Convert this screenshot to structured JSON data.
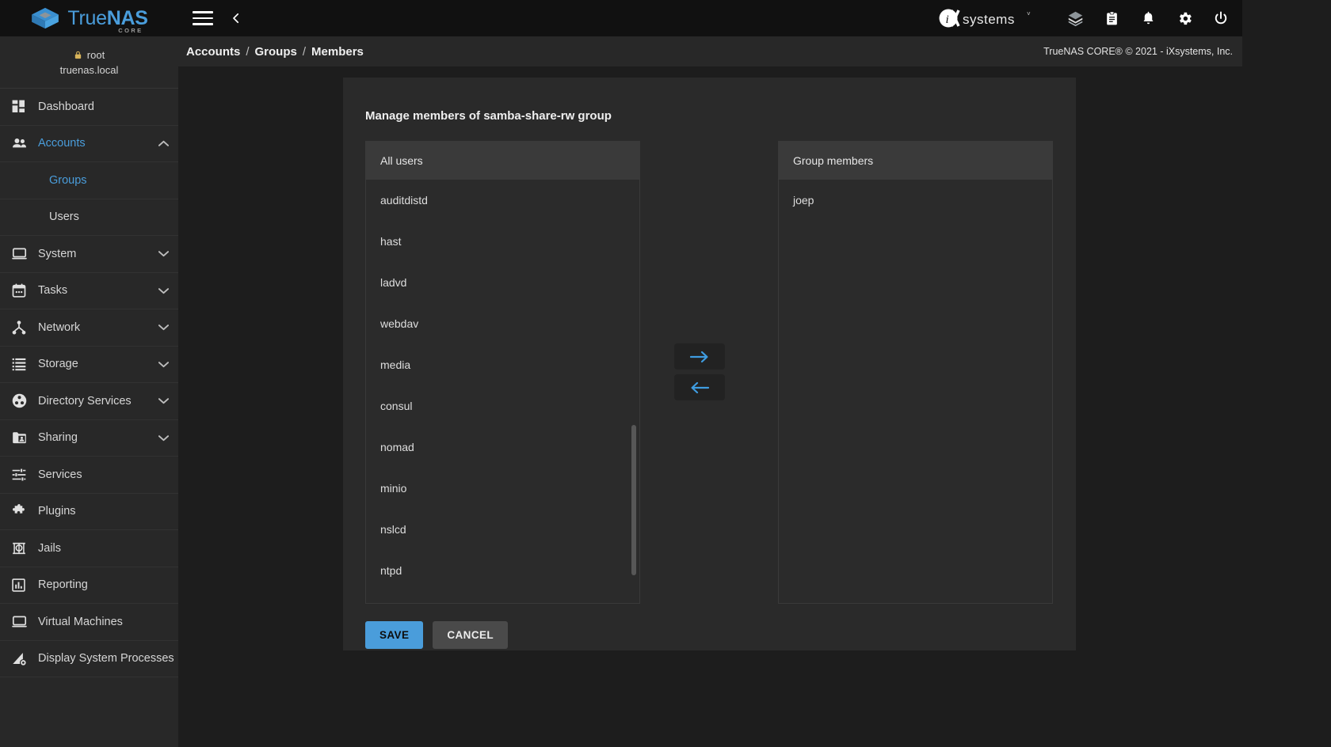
{
  "brand": {
    "name_part1": "True",
    "name_part2": "NAS",
    "edition": "CORE",
    "vendor": "iXsystems"
  },
  "topbar": {
    "menu_icon": "hamburger-icon",
    "back_icon": "chevron-left-icon",
    "icons": [
      {
        "name": "cube-stack-icon",
        "label": ""
      },
      {
        "name": "clipboard-icon",
        "label": ""
      },
      {
        "name": "bell-icon",
        "label": ""
      },
      {
        "name": "gear-icon",
        "label": ""
      },
      {
        "name": "power-icon",
        "label": ""
      }
    ]
  },
  "sidebar": {
    "user": {
      "username": "root",
      "hostname": "truenas.local",
      "lock_icon": "lock-icon"
    },
    "items": [
      {
        "label": "Dashboard",
        "icon": "dashboard-icon",
        "active": false,
        "expandable": false,
        "sub": false
      },
      {
        "label": "Accounts",
        "icon": "accounts-icon",
        "active": true,
        "expandable": true,
        "expanded": true,
        "sub": false
      },
      {
        "label": "Groups",
        "icon": "",
        "active": true,
        "expandable": false,
        "sub": true
      },
      {
        "label": "Users",
        "icon": "",
        "active": false,
        "expandable": false,
        "sub": true
      },
      {
        "label": "System",
        "icon": "system-icon",
        "active": false,
        "expandable": true,
        "expanded": false,
        "sub": false
      },
      {
        "label": "Tasks",
        "icon": "tasks-icon",
        "active": false,
        "expandable": true,
        "expanded": false,
        "sub": false
      },
      {
        "label": "Network",
        "icon": "network-icon",
        "active": false,
        "expandable": true,
        "expanded": false,
        "sub": false
      },
      {
        "label": "Storage",
        "icon": "storage-icon",
        "active": false,
        "expandable": true,
        "expanded": false,
        "sub": false
      },
      {
        "label": "Directory Services",
        "icon": "directory-services-icon",
        "active": false,
        "expandable": true,
        "expanded": false,
        "sub": false
      },
      {
        "label": "Sharing",
        "icon": "sharing-icon",
        "active": false,
        "expandable": true,
        "expanded": false,
        "sub": false
      },
      {
        "label": "Services",
        "icon": "services-icon",
        "active": false,
        "expandable": false,
        "sub": false
      },
      {
        "label": "Plugins",
        "icon": "plugins-icon",
        "active": false,
        "expandable": false,
        "sub": false
      },
      {
        "label": "Jails",
        "icon": "jails-icon",
        "active": false,
        "expandable": false,
        "sub": false
      },
      {
        "label": "Reporting",
        "icon": "reporting-icon",
        "active": false,
        "expandable": false,
        "sub": false
      },
      {
        "label": "Virtual Machines",
        "icon": "virtual-machines-icon",
        "active": false,
        "expandable": false,
        "sub": false
      },
      {
        "label": "Display System Processes",
        "icon": "display-system-processes-icon",
        "active": false,
        "expandable": false,
        "sub": false
      }
    ]
  },
  "breadcrumb": {
    "items": [
      "Accounts",
      "Groups",
      "Members"
    ],
    "separator": "/"
  },
  "copyright": "TrueNAS CORE® © 2021 - iXsystems, Inc.",
  "main": {
    "title": "Manage members of samba-share-rw group",
    "left_panel": {
      "header": "All users",
      "items": [
        "auditdistd",
        "hast",
        "ladvd",
        "webdav",
        "media",
        "consul",
        "nomad",
        "minio",
        "nslcd",
        "ntpd"
      ]
    },
    "right_panel": {
      "header": "Group members",
      "items": [
        "joep"
      ]
    },
    "transfer": {
      "add_icon": "arrow-right-icon",
      "remove_icon": "arrow-left-icon"
    },
    "buttons": {
      "save": "SAVE",
      "cancel": "CANCEL"
    }
  },
  "colors": {
    "accent": "#4a9ddb",
    "topbar_bg": "#111111",
    "sidebar_bg": "#282828",
    "content_bg": "#1d1d1d",
    "card_bg": "#2a2a2a",
    "list_header_bg": "#3a3a3a",
    "cancel_bg": "#4a4a4a"
  }
}
